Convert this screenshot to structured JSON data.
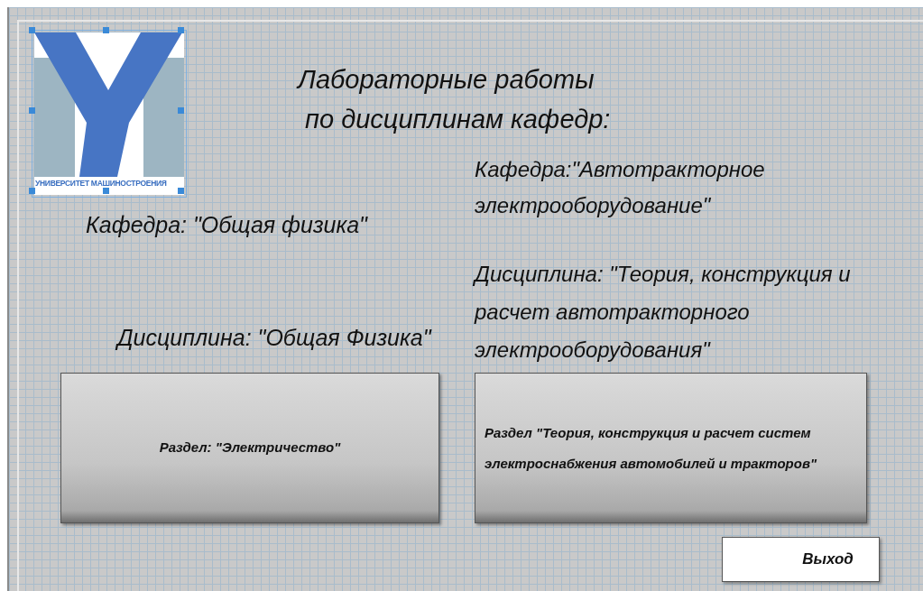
{
  "logo": {
    "caption": "УНИВЕРСИТЕТ МАШИНОСТРОЕНИЯ",
    "selected": true
  },
  "title_lines": [
    "Лабораторные работы",
    " по дисциплинам кафедр:"
  ],
  "left": {
    "department": "Кафедра: \"Общая физика\"",
    "discipline": "Дисциплина: \"Общая Физика\"",
    "button": "Раздел: \"Электричество\""
  },
  "right": {
    "department_lines": [
      "Кафедра:\"Автотракторное",
      "электрооборудование\""
    ],
    "discipline_lines": [
      "Дисциплина: \"Теория, конструкция и",
      "расчет автотракторного",
      "электрооборудования\""
    ],
    "button_lines": [
      "Раздел \"Теория, конструкция и расчет систем",
      "электроснабжения автомобилей и тракторов\""
    ]
  },
  "exit_button": "Выход"
}
